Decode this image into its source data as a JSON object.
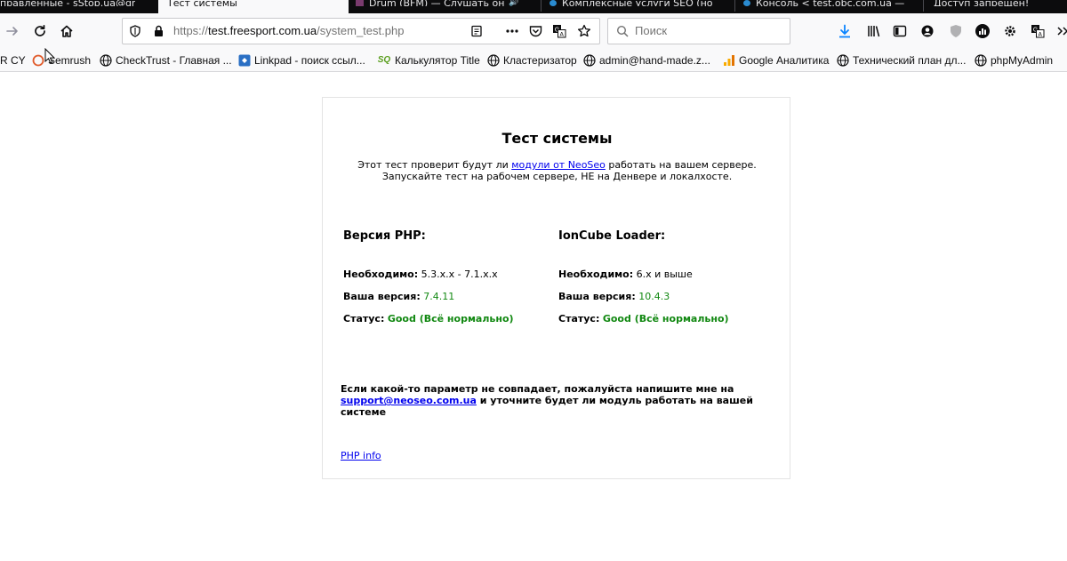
{
  "browser": {
    "tabs": [
      {
        "label": "правленные - sStop.ua@gr",
        "active": false
      },
      {
        "label": "Тест системы",
        "active": true
      },
      {
        "label": "Drum (BFM) — Слушать он",
        "active": false
      },
      {
        "label": "Комплексные услуги SEO (но",
        "active": false
      },
      {
        "label": "Консоль < test.obc.com.ua —",
        "active": false
      },
      {
        "label": "Доступ запрещен!",
        "active": false
      }
    ],
    "url": {
      "scheme": "https://",
      "host": "test.freesport.com.ua",
      "path": "/system_test.php"
    },
    "search_placeholder": "Поиск",
    "bookmarks": [
      {
        "label": "R CY",
        "icon": "none"
      },
      {
        "label": "Semrush",
        "icon": "semrush-icon"
      },
      {
        "label": "CheckTrust - Главная ...",
        "icon": "globe-icon"
      },
      {
        "label": "Linkpad - поиск ссыл...",
        "icon": "linkpad-icon"
      },
      {
        "label": "Калькулятор Title",
        "icon": "sq-icon"
      },
      {
        "label": "Кластеризатор",
        "icon": "globe-icon"
      },
      {
        "label": "admin@hand-made.z...",
        "icon": "globe-icon"
      },
      {
        "label": "Google Аналитика",
        "icon": "analytics-icon"
      },
      {
        "label": "Технический план дл...",
        "icon": "globe-icon"
      },
      {
        "label": "phpMyAdmin",
        "icon": "globe-icon"
      }
    ]
  },
  "page": {
    "title": "Тест системы",
    "intro": {
      "line1_before": "Этот тест проверит будут ли ",
      "line1_link": "модули от NeoSeo",
      "line1_after": " работать на вашем сервере.",
      "line2": "Запускайте тест на рабочем сервере, НЕ на Денвере и локалхосте."
    },
    "php": {
      "heading": "Версия PHP:",
      "required_label": "Необходимо:",
      "required_value": "5.3.x.x - 7.1.x.x",
      "version_label": "Ваша версия:",
      "version_value": "7.4.11",
      "status_label": "Статус:",
      "status_value": "Good (Всё нормально)"
    },
    "ioncube": {
      "heading": "IonCube Loader:",
      "required_label": "Необходимо:",
      "required_value": "6.x и выше",
      "version_label": "Ваша версия:",
      "version_value": "10.4.3",
      "status_label": "Статус:",
      "status_value": "Good (Всё нормально)"
    },
    "notice": {
      "before": "Если какой-то параметр не совпадает, пожалуйста напишите мне на ",
      "email": "support@neoseo.com.ua",
      "after": " и уточните будет ли модуль работать на вашей системе"
    },
    "phpinfo_link": "PHP info"
  },
  "colors": {
    "ok_green": "#118811",
    "link_blue": "#0000ee",
    "tabstrip_bg": "#0c0c0d",
    "toolbar_bg": "#f9f9fa",
    "download_blue": "#0a84ff"
  }
}
